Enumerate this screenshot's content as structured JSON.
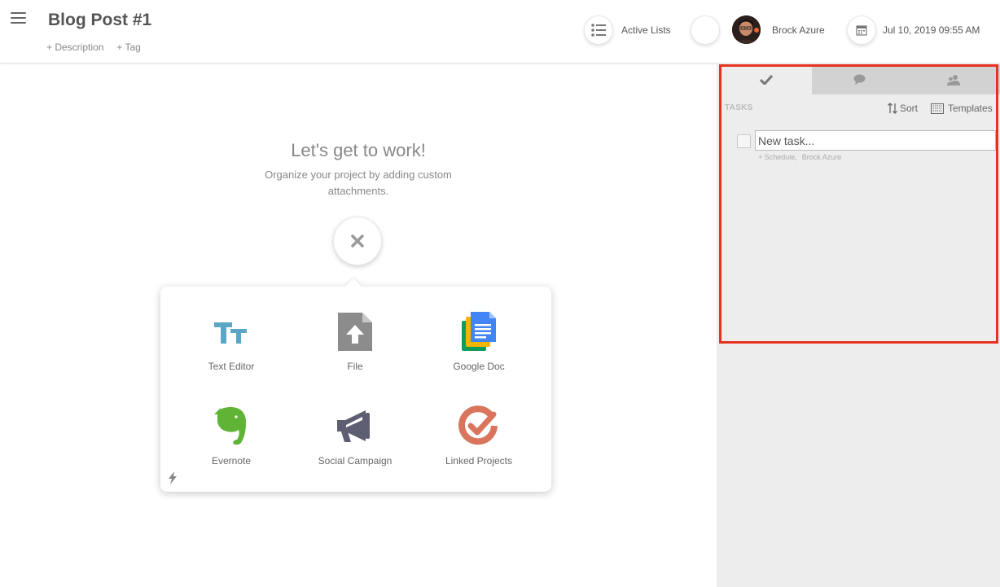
{
  "header": {
    "title": "Blog Post #1",
    "add_description": "+ Description",
    "add_tag": "+ Tag",
    "active_lists_label": "Active Lists",
    "user_name": "Brock Azure",
    "datetime": "Jul 10, 2019 09:55 AM"
  },
  "main": {
    "heading": "Let's get to work!",
    "subtext": "Organize your project by adding custom attachments.",
    "attachments": [
      {
        "label": "Text Editor",
        "icon": "text-editor-icon"
      },
      {
        "label": "File",
        "icon": "file-upload-icon"
      },
      {
        "label": "Google Doc",
        "icon": "google-doc-icon"
      },
      {
        "label": "Evernote",
        "icon": "evernote-icon"
      },
      {
        "label": "Social Campaign",
        "icon": "megaphone-icon"
      },
      {
        "label": "Linked Projects",
        "icon": "linked-projects-icon"
      }
    ]
  },
  "sidebar": {
    "tabs": [
      {
        "icon": "checkmark-icon",
        "active": true
      },
      {
        "icon": "comment-icon",
        "active": false
      },
      {
        "icon": "users-icon",
        "active": false
      }
    ],
    "tasks_label": "TASKS",
    "sort_label": "Sort",
    "templates_label": "Templates",
    "new_task_placeholder": "New task...",
    "schedule_link": "+ Schedule,",
    "assignee": "Brock Azure"
  },
  "colors": {
    "highlight": "#e6321f",
    "text_editor": "#5aa6c4",
    "evernote": "#5fb335",
    "linked_projects": "#d9755d",
    "sidebar_bg": "#ededed"
  }
}
